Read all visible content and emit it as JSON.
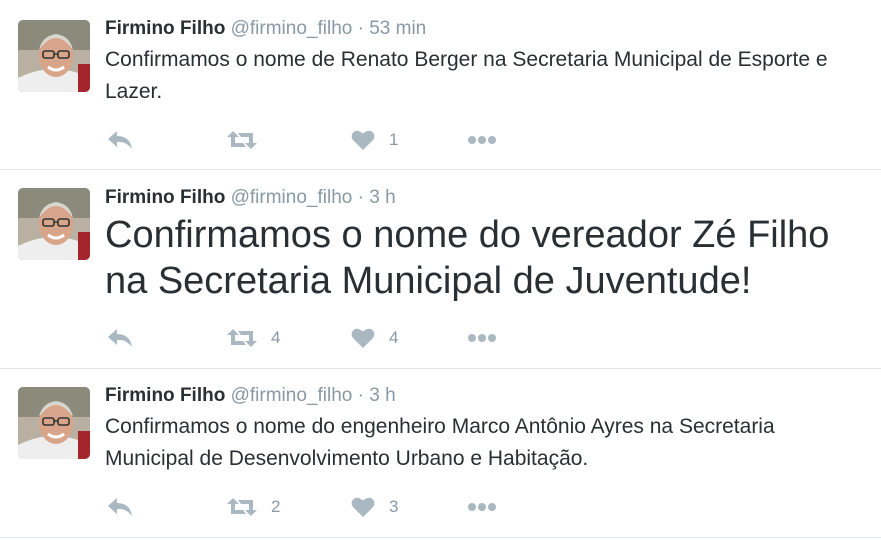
{
  "colors": {
    "icon": "#aab8c2",
    "muted": "#8899a6",
    "text": "#292f33",
    "divider": "#e1e8ed"
  },
  "icons": [
    "reply-icon",
    "retweet-icon",
    "like-icon",
    "more-icon"
  ],
  "tweets": [
    {
      "name": "Firmino Filho",
      "handle": "@firmino_filho",
      "separator": "·",
      "time": "53 min",
      "text": "Confirmamos o nome de Renato Berger na Secretaria Municipal de Esporte e Lazer.",
      "retweets": "",
      "likes": "1"
    },
    {
      "name": "Firmino Filho",
      "handle": "@firmino_filho",
      "separator": "·",
      "time": "3 h",
      "text": "Confirmamos o nome do vereador Zé Filho na Secretaria Municipal de Juventude!",
      "retweets": "4",
      "likes": "4"
    },
    {
      "name": "Firmino Filho",
      "handle": "@firmino_filho",
      "separator": "·",
      "time": "3 h",
      "text": "Confirmamos o nome do engenheiro Marco Antônio Ayres na Secretaria Municipal de Desenvolvimento Urbano e Habitação.",
      "retweets": "2",
      "likes": "3"
    }
  ]
}
